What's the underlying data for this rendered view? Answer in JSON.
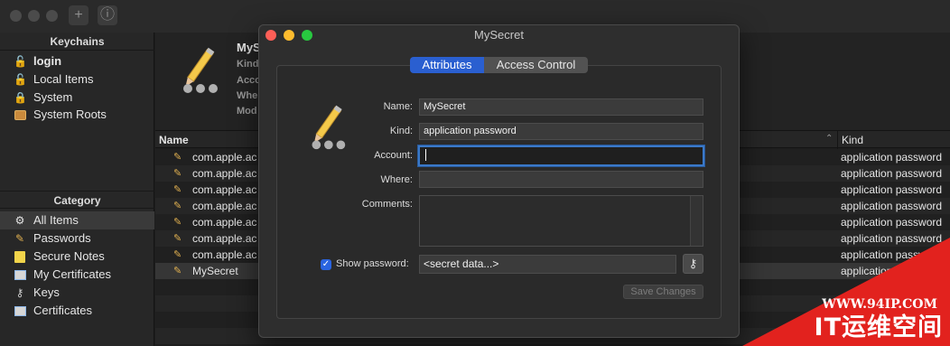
{
  "sidebar": {
    "keychains_title": "Keychains",
    "keychains": [
      {
        "label": "login",
        "icon": "lock-open-icon"
      },
      {
        "label": "Local Items",
        "icon": "lock-open-icon"
      },
      {
        "label": "System",
        "icon": "lock-icon"
      },
      {
        "label": "System Roots",
        "icon": "cabinet-icon"
      }
    ],
    "category_title": "Category",
    "categories": [
      {
        "label": "All Items",
        "icon": "all-items-icon"
      },
      {
        "label": "Passwords",
        "icon": "pencil-icon"
      },
      {
        "label": "Secure Notes",
        "icon": "note-icon"
      },
      {
        "label": "My Certificates",
        "icon": "certificate-icon"
      },
      {
        "label": "Keys",
        "icon": "key-icon"
      },
      {
        "label": "Certificates",
        "icon": "certificate-icon"
      }
    ]
  },
  "detail": {
    "name": "MyS",
    "labels": [
      "Kind",
      "Acco",
      "Whe",
      "Mod"
    ]
  },
  "list": {
    "header_name": "Name",
    "header_kind": "Kind",
    "rows": [
      {
        "name": "com.apple.ac",
        "kind": "application password"
      },
      {
        "name": "com.apple.ac",
        "kind": "application password"
      },
      {
        "name": "com.apple.ac",
        "kind": "application password"
      },
      {
        "name": "com.apple.ac",
        "kind": "application password"
      },
      {
        "name": "com.apple.ac",
        "kind": "application password"
      },
      {
        "name": "com.apple.ac",
        "kind": "application password"
      },
      {
        "name": "com.apple.ac",
        "kind": "application password"
      },
      {
        "name": "MySecret",
        "kind": "application password"
      }
    ]
  },
  "dialog": {
    "title": "MySecret",
    "tabs": [
      "Attributes",
      "Access Control"
    ],
    "active_tab": "Attributes",
    "fields": {
      "name_label": "Name:",
      "name_value": "MySecret",
      "kind_label": "Kind:",
      "kind_value": "application password",
      "account_label": "Account:",
      "account_value": "",
      "where_label": "Where:",
      "where_value": "",
      "comments_label": "Comments:",
      "comments_value": "",
      "show_password_label": "Show password:",
      "show_password_checked": true,
      "password_value": "<secret data...>"
    },
    "save_label": "Save Changes"
  },
  "watermark": {
    "url": "WWW.94IP.COM",
    "brand": "IT运维空间"
  },
  "colors": {
    "accent": "#2a5fd0",
    "close": "#fe5f57",
    "minimize": "#febc2e",
    "zoom": "#28c840",
    "watermark": "#e2221e"
  }
}
